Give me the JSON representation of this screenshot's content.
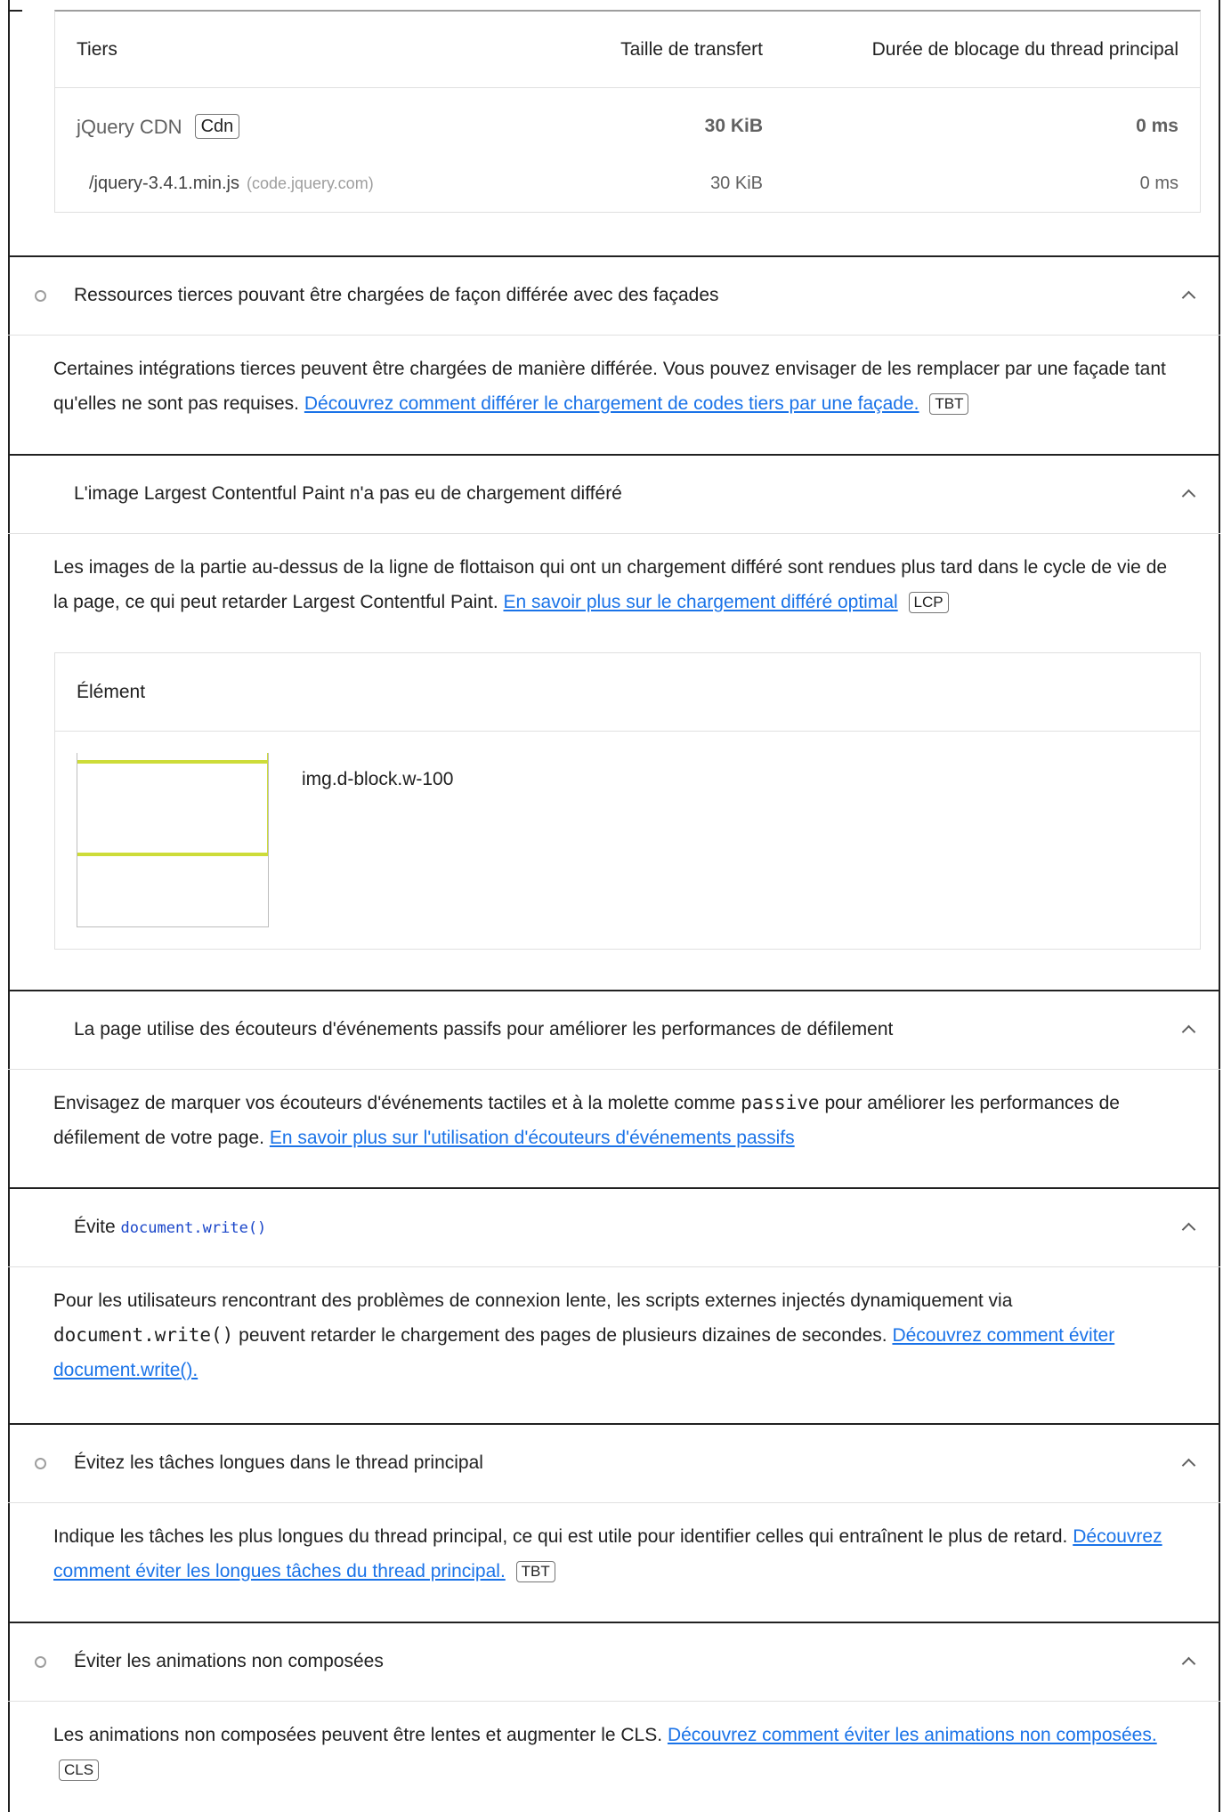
{
  "third_party_table": {
    "headers": {
      "tiers": "Tiers",
      "transfer_size": "Taille de transfert",
      "main_thread_blocking": "Durée de blocage du thread principal"
    },
    "group": {
      "name": "jQuery CDN",
      "badge": "Cdn",
      "transfer_size": "30 KiB",
      "blocking_time": "0 ms"
    },
    "item": {
      "url": "/jquery-3.4.1.min.js",
      "host": "(code.jquery.com)",
      "transfer_size": "30 KiB",
      "blocking_time": "0 ms"
    }
  },
  "audits": [
    {
      "title": "Ressources tierces pouvant être chargées de façon différée avec des façades",
      "description": "Certaines intégrations tierces peuvent être chargées de manière différée. Vous pouvez envisager de les remplacer par une façade tant qu'elles ne sont pas requises.",
      "link": "Découvrez comment différer le chargement de codes tiers par une façade.",
      "badge": "TBT"
    },
    {
      "title": "L'image Largest Contentful Paint n'a pas eu de chargement différé",
      "description": "Les images de la partie au-dessus de la ligne de flottaison qui ont un chargement différé sont rendues plus tard dans le cycle de vie de la page, ce qui peut retarder Largest Contentful Paint.",
      "link": "En savoir plus sur le chargement différé optimal",
      "badge": "LCP",
      "element_table": {
        "header": "Élément",
        "selector": "img.d-block.w-100"
      }
    },
    {
      "title": "La page utilise des écouteurs d'événements passifs pour améliorer les performances de défilement",
      "description_before": "Envisagez de marquer vos écouteurs d'événements tactiles et à la molette comme",
      "description_code": "passive",
      "description_after": "pour améliorer les performances de défilement de votre page.",
      "link": "En savoir plus sur l'utilisation d'écouteurs d'événements passifs"
    },
    {
      "title_prefix": "Évite",
      "title_code": "document.write()",
      "description_before": "Pour les utilisateurs rencontrant des problèmes de connexion lente, les scripts externes injectés dynamiquement via",
      "description_code": "document.write()",
      "description_after": "peuvent retarder le chargement des pages de plusieurs dizaines de secondes.",
      "link": "Découvrez comment éviter document.write()."
    },
    {
      "title": "Évitez les tâches longues dans le thread principal",
      "description": "Indique les tâches les plus longues du thread principal, ce qui est utile pour identifier celles qui entraînent le plus de retard.",
      "link": "Découvrez comment éviter les longues tâches du thread principal.",
      "badge": "TBT"
    },
    {
      "title": "Éviter les animations non composées",
      "description": "Les animations non composées peuvent être lentes et augmenter le CLS.",
      "link": "Découvrez comment éviter les animations non composées.",
      "badge": "CLS"
    }
  ],
  "colors": {
    "link": "#1a73e8",
    "code": "#1a46c9",
    "thumb_accent": "#cddc39"
  }
}
